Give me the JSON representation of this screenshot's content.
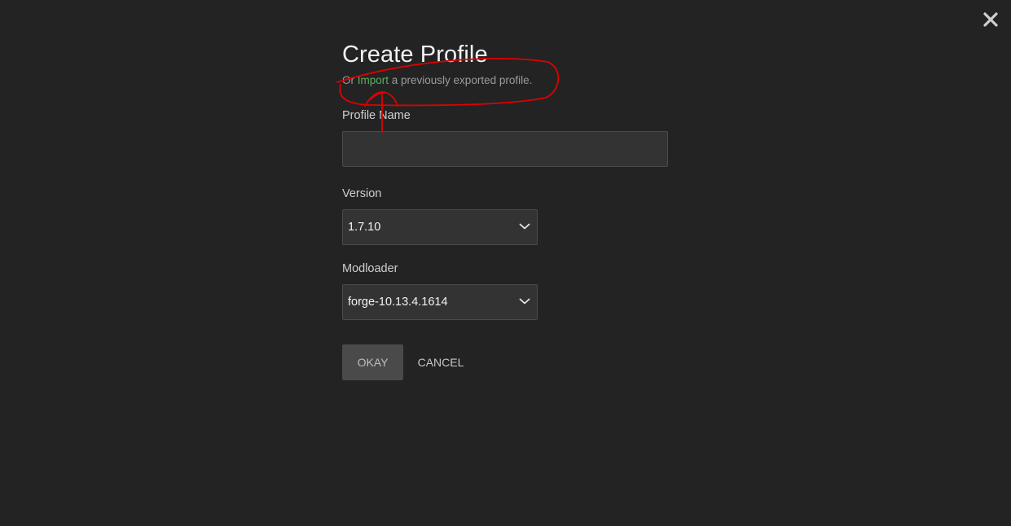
{
  "dialog": {
    "title": "Create Profile",
    "subtitle": {
      "prefix": "Or ",
      "link": "Import",
      "suffix": " a previously exported profile."
    },
    "profile_name": {
      "label": "Profile Name",
      "value": "",
      "placeholder": ""
    },
    "version": {
      "label": "Version",
      "selected": "1.7.10"
    },
    "modloader": {
      "label": "Modloader",
      "selected": "forge-10.13.4.1614"
    },
    "buttons": {
      "okay": "OKAY",
      "cancel": "CANCEL"
    }
  },
  "icons": {
    "close": "close-icon",
    "dropdown": "chevron-down-icon"
  },
  "colors": {
    "background": "#232323",
    "input_background": "#333333",
    "link": "#5fae5f",
    "annotation": "#e00000",
    "okay_button": "#4a4a4a"
  }
}
